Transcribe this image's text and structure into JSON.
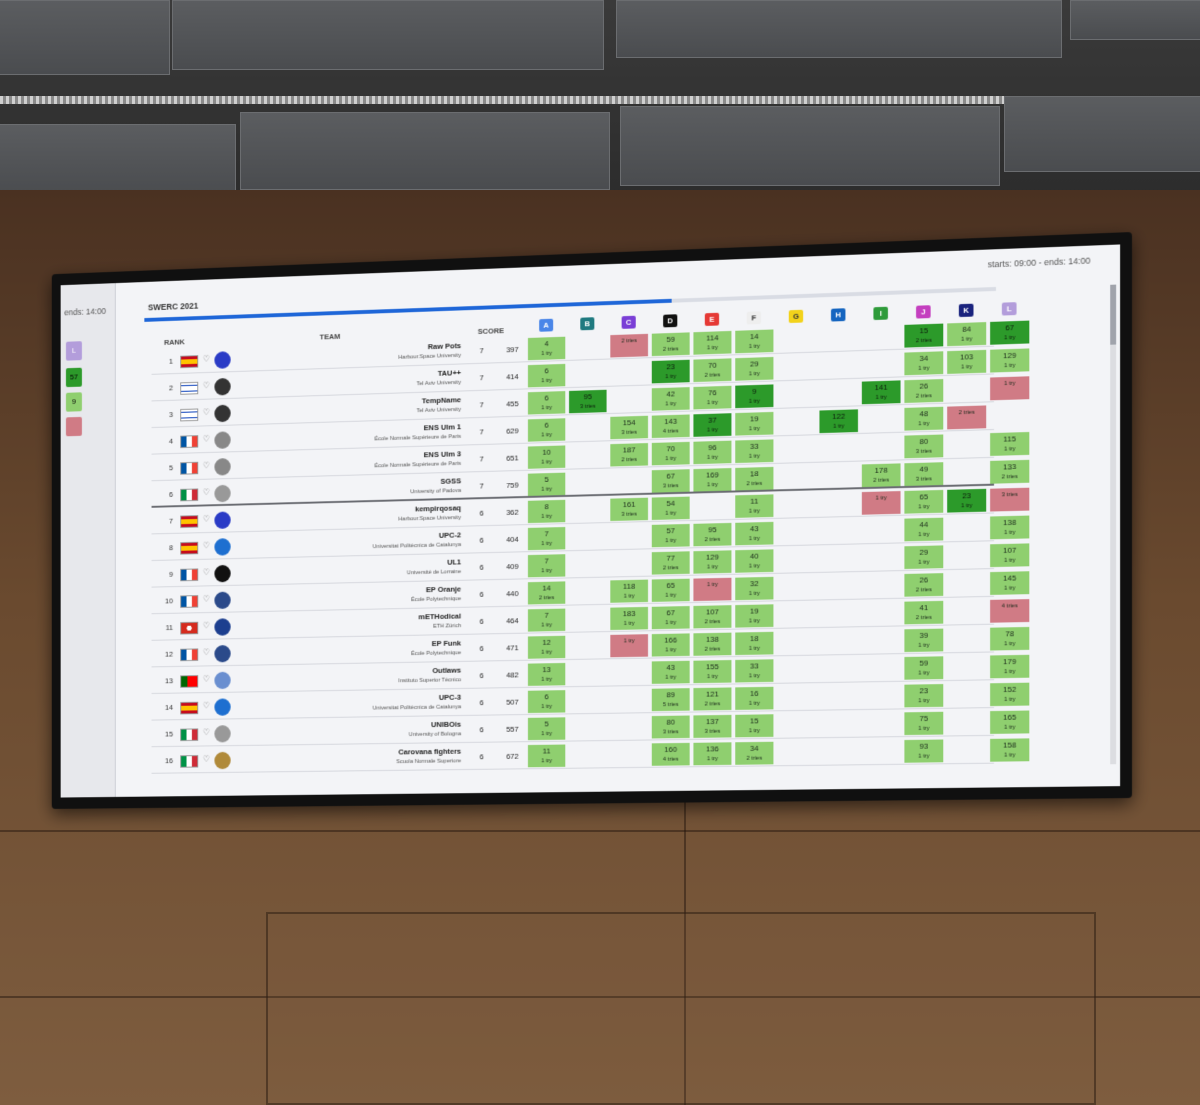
{
  "sliver": {
    "text": "ends: 14:00",
    "chip": "L",
    "n1": "57",
    "n2": "9"
  },
  "header": {
    "title": "SWERC 2021",
    "clock": "starts: 09:00 - ends: 14:00",
    "col_rank": "RANK",
    "col_team": "TEAM",
    "col_score": "SCORE",
    "progress": 0.63
  },
  "problems": [
    {
      "letter": "A",
      "color": "#4a86e8"
    },
    {
      "letter": "B",
      "color": "#1f7a80"
    },
    {
      "letter": "C",
      "color": "#7a3ed6"
    },
    {
      "letter": "D",
      "color": "#111111"
    },
    {
      "letter": "E",
      "color": "#e53935"
    },
    {
      "letter": "F",
      "color": "#eeeeee"
    },
    {
      "letter": "G",
      "color": "#f2d21b"
    },
    {
      "letter": "H",
      "color": "#1565c0"
    },
    {
      "letter": "I",
      "color": "#2e9b3a"
    },
    {
      "letter": "J",
      "color": "#c43fbf"
    },
    {
      "letter": "K",
      "color": "#1a237e"
    },
    {
      "letter": "L",
      "color": "#b39ddb"
    }
  ],
  "rows": [
    {
      "rank": "1",
      "name": "Raw Pots",
      "uni": "Harbour.Space University",
      "solved": "7",
      "penalty": "397",
      "flag": "es",
      "logo": "#2a3bc6",
      "cells": [
        [
          "g",
          "4",
          "1 try"
        ],
        null,
        [
          "r",
          "",
          "2 tries"
        ],
        [
          "g",
          "59",
          "2 tries"
        ],
        [
          "g",
          "114",
          "1 try"
        ],
        [
          "g",
          "14",
          "1 try"
        ],
        null,
        null,
        null,
        [
          "f",
          "15",
          "2 tries"
        ],
        [
          "g",
          "84",
          "1 try"
        ],
        [
          "f",
          "67",
          "1 try"
        ]
      ]
    },
    {
      "rank": "2",
      "name": "TAU++",
      "uni": "Tel Aviv University",
      "solved": "7",
      "penalty": "414",
      "flag": "il",
      "logo": "#333333",
      "cells": [
        [
          "g",
          "6",
          "1 try"
        ],
        null,
        null,
        [
          "f",
          "23",
          "1 try"
        ],
        [
          "g",
          "70",
          "2 tries"
        ],
        [
          "g",
          "29",
          "1 try"
        ],
        null,
        null,
        null,
        [
          "g",
          "34",
          "1 try"
        ],
        [
          "g",
          "103",
          "1 try"
        ],
        [
          "g",
          "129",
          "1 try"
        ]
      ]
    },
    {
      "rank": "3",
      "name": "TempName",
      "uni": "Tel Aviv University",
      "solved": "7",
      "penalty": "455",
      "flag": "il",
      "logo": "#333333",
      "cells": [
        [
          "g",
          "6",
          "1 try"
        ],
        [
          "f",
          "95",
          "3 tries"
        ],
        null,
        [
          "g",
          "42",
          "1 try"
        ],
        [
          "g",
          "76",
          "1 try"
        ],
        [
          "f",
          "9",
          "1 try"
        ],
        null,
        null,
        [
          "f",
          "141",
          "1 try"
        ],
        [
          "g",
          "26",
          "2 tries"
        ],
        null,
        [
          "r",
          "",
          "1 try"
        ]
      ]
    },
    {
      "rank": "4",
      "name": "ENS Ulm 1",
      "uni": "École Normale Supérieure de Paris",
      "solved": "7",
      "penalty": "629",
      "flag": "fr",
      "logo": "#888888",
      "cells": [
        [
          "g",
          "6",
          "1 try"
        ],
        null,
        [
          "g",
          "154",
          "3 tries"
        ],
        [
          "g",
          "143",
          "4 tries"
        ],
        [
          "f",
          "37",
          "1 try"
        ],
        [
          "g",
          "19",
          "1 try"
        ],
        null,
        [
          "f",
          "122",
          "1 try"
        ],
        null,
        [
          "g",
          "48",
          "1 try"
        ],
        [
          "r",
          "",
          "2 tries"
        ],
        null
      ]
    },
    {
      "rank": "5",
      "name": "ENS Ulm 3",
      "uni": "École Normale Supérieure de Paris",
      "solved": "7",
      "penalty": "651",
      "flag": "fr",
      "logo": "#888888",
      "cells": [
        [
          "g",
          "10",
          "1 try"
        ],
        null,
        [
          "g",
          "187",
          "2 tries"
        ],
        [
          "g",
          "70",
          "1 try"
        ],
        [
          "g",
          "96",
          "1 try"
        ],
        [
          "g",
          "33",
          "1 try"
        ],
        null,
        null,
        null,
        [
          "g",
          "80",
          "3 tries"
        ],
        null,
        [
          "g",
          "115",
          "1 try"
        ]
      ]
    },
    {
      "rank": "6",
      "name": "SGSS",
      "uni": "University of Padova",
      "solved": "7",
      "penalty": "759",
      "flag": "it",
      "logo": "#999999",
      "cells": [
        [
          "g",
          "5",
          "1 try"
        ],
        null,
        null,
        [
          "g",
          "67",
          "3 tries"
        ],
        [
          "g",
          "169",
          "1 try"
        ],
        [
          "g",
          "18",
          "2 tries"
        ],
        null,
        null,
        [
          "g",
          "178",
          "2 tries"
        ],
        [
          "g",
          "49",
          "3 tries"
        ],
        null,
        [
          "g",
          "133",
          "2 tries"
        ]
      ]
    },
    {
      "rank": "7",
      "name": "kempirqosaq",
      "uni": "Harbour.Space University",
      "solved": "6",
      "penalty": "362",
      "flag": "es",
      "logo": "#2a3bc6",
      "cells": [
        [
          "g",
          "8",
          "1 try"
        ],
        null,
        [
          "g",
          "161",
          "3 tries"
        ],
        [
          "g",
          "54",
          "1 try"
        ],
        null,
        [
          "g",
          "11",
          "1 try"
        ],
        null,
        null,
        [
          "r",
          "",
          "1 try"
        ],
        [
          "g",
          "65",
          "1 try"
        ],
        [
          "f",
          "23",
          "1 try"
        ],
        [
          "r",
          "",
          "3 tries"
        ]
      ]
    },
    {
      "rank": "8",
      "name": "UPC-2",
      "uni": "Universitat Politècnica de Catalunya",
      "solved": "6",
      "penalty": "404",
      "flag": "es",
      "logo": "#1e6fd0",
      "cells": [
        [
          "g",
          "7",
          "1 try"
        ],
        null,
        null,
        [
          "g",
          "57",
          "1 try"
        ],
        [
          "g",
          "95",
          "2 tries"
        ],
        [
          "g",
          "43",
          "1 try"
        ],
        null,
        null,
        null,
        [
          "g",
          "44",
          "1 try"
        ],
        null,
        [
          "g",
          "138",
          "1 try"
        ]
      ]
    },
    {
      "rank": "9",
      "name": "UL1",
      "uni": "Université de Lorraine",
      "solved": "6",
      "penalty": "409",
      "flag": "fr",
      "logo": "#111111",
      "cells": [
        [
          "g",
          "7",
          "1 try"
        ],
        null,
        null,
        [
          "g",
          "77",
          "2 tries"
        ],
        [
          "g",
          "129",
          "1 try"
        ],
        [
          "g",
          "40",
          "1 try"
        ],
        null,
        null,
        null,
        [
          "g",
          "29",
          "1 try"
        ],
        null,
        [
          "g",
          "107",
          "1 try"
        ]
      ]
    },
    {
      "rank": "10",
      "name": "EP Oranje",
      "uni": "École Polytechnique",
      "solved": "6",
      "penalty": "440",
      "flag": "fr",
      "logo": "#2b4a8a",
      "cells": [
        [
          "g",
          "14",
          "2 tries"
        ],
        null,
        [
          "g",
          "118",
          "1 try"
        ],
        [
          "g",
          "65",
          "1 try"
        ],
        [
          "r",
          "",
          "1 try"
        ],
        [
          "g",
          "32",
          "1 try"
        ],
        null,
        null,
        null,
        [
          "g",
          "26",
          "2 tries"
        ],
        null,
        [
          "g",
          "145",
          "1 try"
        ]
      ]
    },
    {
      "rank": "11",
      "name": "mETHodical",
      "uni": "ETH Zürich",
      "solved": "6",
      "penalty": "464",
      "flag": "ch",
      "logo": "#1d3f8f",
      "cells": [
        [
          "g",
          "7",
          "1 try"
        ],
        null,
        [
          "g",
          "183",
          "1 try"
        ],
        [
          "g",
          "67",
          "1 try"
        ],
        [
          "g",
          "107",
          "2 tries"
        ],
        [
          "g",
          "19",
          "1 try"
        ],
        null,
        null,
        null,
        [
          "g",
          "41",
          "2 tries"
        ],
        null,
        [
          "r",
          "",
          "4 tries"
        ]
      ]
    },
    {
      "rank": "12",
      "name": "EP Funk",
      "uni": "École Polytechnique",
      "solved": "6",
      "penalty": "471",
      "flag": "fr",
      "logo": "#2b4a8a",
      "cells": [
        [
          "g",
          "12",
          "1 try"
        ],
        null,
        [
          "r",
          "",
          "1 try"
        ],
        [
          "g",
          "166",
          "1 try"
        ],
        [
          "g",
          "138",
          "2 tries"
        ],
        [
          "g",
          "18",
          "1 try"
        ],
        null,
        null,
        null,
        [
          "g",
          "39",
          "1 try"
        ],
        null,
        [
          "g",
          "78",
          "1 try"
        ]
      ]
    },
    {
      "rank": "13",
      "name": "Outlaws",
      "uni": "Instituto Superior Técnico",
      "solved": "6",
      "penalty": "482",
      "flag": "pt",
      "logo": "#6a8fd0",
      "cells": [
        [
          "g",
          "13",
          "1 try"
        ],
        null,
        null,
        [
          "g",
          "43",
          "1 try"
        ],
        [
          "g",
          "155",
          "1 try"
        ],
        [
          "g",
          "33",
          "1 try"
        ],
        null,
        null,
        null,
        [
          "g",
          "59",
          "1 try"
        ],
        null,
        [
          "g",
          "179",
          "1 try"
        ]
      ]
    },
    {
      "rank": "14",
      "name": "UPC-3",
      "uni": "Universitat Politècnica de Catalunya",
      "solved": "6",
      "penalty": "507",
      "flag": "es",
      "logo": "#1e6fd0",
      "cells": [
        [
          "g",
          "6",
          "1 try"
        ],
        null,
        null,
        [
          "g",
          "89",
          "5 tries"
        ],
        [
          "g",
          "121",
          "2 tries"
        ],
        [
          "g",
          "16",
          "1 try"
        ],
        null,
        null,
        null,
        [
          "g",
          "23",
          "1 try"
        ],
        null,
        [
          "g",
          "152",
          "1 try"
        ]
      ]
    },
    {
      "rank": "15",
      "name": "UNIBOis",
      "uni": "University of Bologna",
      "solved": "6",
      "penalty": "557",
      "flag": "it",
      "logo": "#999999",
      "cells": [
        [
          "g",
          "5",
          "1 try"
        ],
        null,
        null,
        [
          "g",
          "80",
          "3 tries"
        ],
        [
          "g",
          "137",
          "3 tries"
        ],
        [
          "g",
          "15",
          "1 try"
        ],
        null,
        null,
        null,
        [
          "g",
          "75",
          "1 try"
        ],
        null,
        [
          "g",
          "165",
          "1 try"
        ]
      ]
    },
    {
      "rank": "16",
      "name": "Carovana fighters",
      "uni": "Scuola Normale Superiore",
      "solved": "6",
      "penalty": "672",
      "flag": "it",
      "logo": "#b08a3a",
      "cells": [
        [
          "g",
          "11",
          "1 try"
        ],
        null,
        null,
        [
          "g",
          "160",
          "4 tries"
        ],
        [
          "g",
          "136",
          "1 try"
        ],
        [
          "g",
          "34",
          "2 tries"
        ],
        null,
        null,
        null,
        [
          "g",
          "93",
          "1 try"
        ],
        null,
        [
          "g",
          "158",
          "1 try"
        ]
      ]
    }
  ]
}
